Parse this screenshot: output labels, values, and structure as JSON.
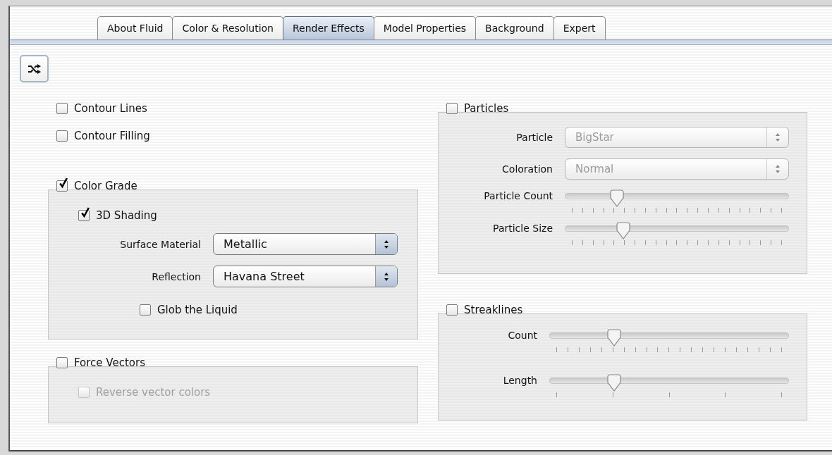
{
  "tabs": [
    {
      "label": "About Fluid",
      "selected": false
    },
    {
      "label": "Color & Resolution",
      "selected": false
    },
    {
      "label": "Render Effects",
      "selected": true
    },
    {
      "label": "Model Properties",
      "selected": false
    },
    {
      "label": "Background",
      "selected": false
    },
    {
      "label": "Expert",
      "selected": false
    }
  ],
  "left_column": [
    {
      "kind": "checkbox",
      "label": "Contour Lines",
      "checked": false,
      "disabled": false
    },
    {
      "kind": "checkbox",
      "label": "Contour Filling",
      "checked": false,
      "disabled": false
    },
    {
      "kind": "group",
      "label": "Color Grade",
      "checked": true,
      "disabled": false,
      "items": [
        {
          "kind": "checkbox",
          "label": "3D Shading",
          "checked": true,
          "disabled": false
        },
        {
          "kind": "popup",
          "label": "Surface Material",
          "value": "Metallic",
          "disabled": false
        },
        {
          "kind": "popup",
          "label": "Reflection",
          "value": "Havana Street",
          "disabled": false
        },
        {
          "kind": "option",
          "label": "Glob the Liquid",
          "checked": false,
          "disabled": false
        }
      ]
    },
    {
      "kind": "group",
      "label": "Force Vectors",
      "checked": false,
      "disabled": false,
      "items": [
        {
          "kind": "checkbox",
          "label": "Reverse vector colors",
          "checked": false,
          "disabled": true
        }
      ]
    }
  ],
  "right_column": [
    {
      "kind": "group",
      "label": "Particles",
      "checked": false,
      "disabled": false,
      "items": [
        {
          "kind": "popup",
          "label": "Particle",
          "value": "BigStar",
          "disabled": true
        },
        {
          "kind": "popup",
          "label": "Coloration",
          "value": "Normal",
          "disabled": true
        },
        {
          "kind": "slider",
          "label": "Particle Count",
          "level": 0.23
        },
        {
          "kind": "slider",
          "label": "Particle Size",
          "level": 0.26
        }
      ]
    },
    {
      "kind": "group",
      "label": "Streaklines",
      "checked": false,
      "disabled": false,
      "items": [
        {
          "kind": "slider",
          "label": "Count",
          "level": 0.27
        },
        {
          "kind": "notched",
          "label": "Length",
          "level": 0.27
        }
      ]
    }
  ]
}
